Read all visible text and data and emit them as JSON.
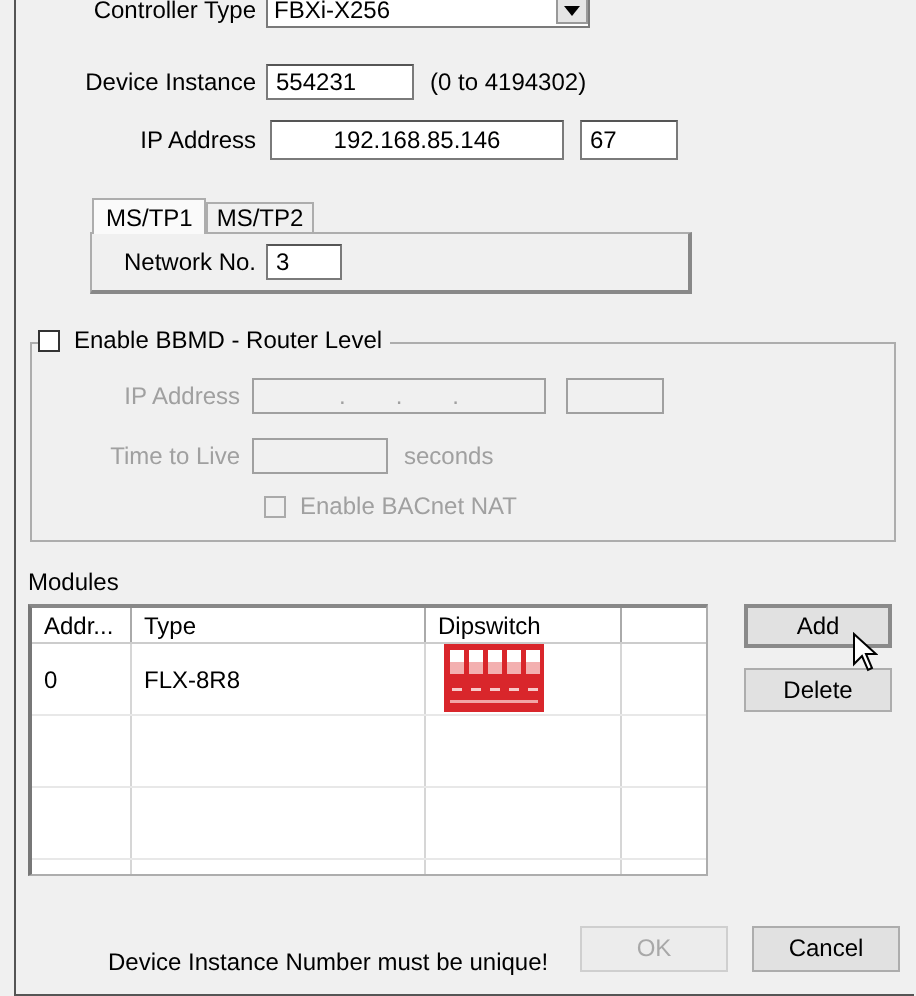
{
  "controller_type": {
    "label": "Controller Type",
    "value": "FBXi-X256"
  },
  "device_instance": {
    "label": "Device Instance",
    "value": "554231",
    "hint": "(0 to 4194302)"
  },
  "ip_address": {
    "label": "IP Address",
    "parts": [
      "192",
      ".",
      "168",
      ".",
      "85",
      ".",
      "146"
    ],
    "port": "67"
  },
  "tabs": [
    {
      "label": "MS/TP1",
      "selected": true
    },
    {
      "label": "MS/TP2",
      "selected": false
    }
  ],
  "network_no": {
    "label": "Network No.",
    "value": "3"
  },
  "bbmd": {
    "label": "Enable BBMD - Router Level",
    "checked": false,
    "ip_label": "IP Address",
    "ip_dots": [
      ".",
      ".",
      "."
    ],
    "ttl_label": "Time to Live",
    "ttl_unit": "seconds",
    "nat": {
      "label": "Enable BACnet NAT",
      "checked": false
    }
  },
  "modules": {
    "label": "Modules",
    "columns": [
      "Addr...",
      "Type",
      "Dipswitch"
    ],
    "rows": [
      {
        "address": "0",
        "type": "FLX-8R8"
      }
    ]
  },
  "side_buttons": [
    {
      "label": "Add",
      "disabled": false
    },
    {
      "label": "Delete",
      "disabled": false
    }
  ],
  "message": "Device Instance Number must be unique!",
  "footer_buttons": [
    {
      "label": "OK",
      "disabled": true
    },
    {
      "label": "Cancel",
      "disabled": false
    }
  ]
}
